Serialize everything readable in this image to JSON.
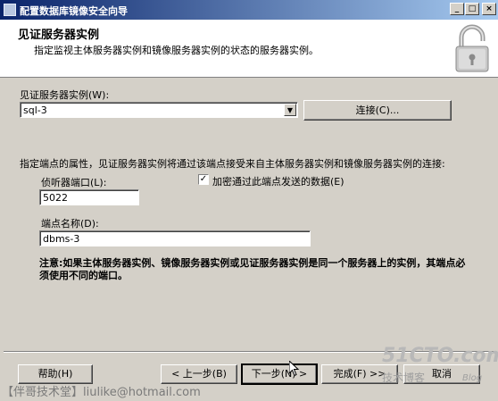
{
  "window": {
    "title": "配置数据库镜像安全向导",
    "controls": {
      "minimize": "_",
      "maximize": "□",
      "close": "×"
    }
  },
  "header": {
    "title": "见证服务器实例",
    "subtitle": "指定监视主体服务器实例和镜像服务器实例的状态的服务器实例。",
    "icon": "lock-icon"
  },
  "form": {
    "witness_label": "见证服务器实例(W):",
    "witness_value": "sql-3",
    "connect_button": "连接(C)...",
    "endpoint_desc": "指定端点的属性，见证服务器实例将通过该端点接受来自主体服务器实例和镜像服务器实例的连接:",
    "port_label": "侦听器端口(L):",
    "port_value": "5022",
    "encrypt_label": "加密通过此端点发送的数据(E)",
    "encrypt_checked": "✓",
    "endpoint_name_label": "端点名称(D):",
    "endpoint_name_value": "dbms-3",
    "note": "注意:如果主体服务器实例、镜像服务器实例或见证服务器实例是同一个服务器上的实例，其端点必须使用不同的端口。"
  },
  "buttons": {
    "help": "帮助(H)",
    "back": "< 上一步(B)",
    "next": "下一步(N) >",
    "finish": "完成(F) >>",
    "cancel": "取消"
  },
  "watermarks": {
    "author": "【伴哥技术堂】liulike@hotmail.com",
    "site": "51CTO.com",
    "blog_label": "技术博客",
    "blog": "Blog"
  }
}
